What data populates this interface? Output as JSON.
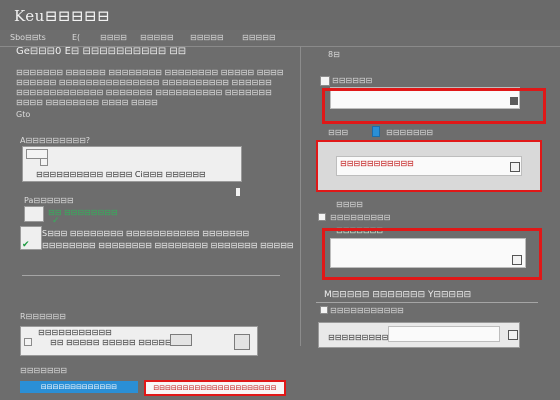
{
  "header": {
    "title": "Keu⊟⊟⊟⊟⊟"
  },
  "tabs": [
    "Sbo⊟⊟ts",
    "E(",
    "⊟⊟⊟⊟",
    "⊟⊟⊟⊟⊟",
    "⊟⊟⊟⊟⊟",
    "⊟⊟⊟⊟⊟"
  ],
  "left": {
    "heading": "Ge⊟⊟⊟0 E⊟ ⊟⊟⊟⊟⊟⊟⊟⊟⊟⊟ ⊟⊟",
    "para_lines": [
      "⊟⊟⊟⊟⊟⊟⊟ ⊟⊟⊟⊟⊟⊟ ⊟⊟⊟⊟⊟⊟⊟⊟ ⊟⊟⊟⊟⊟⊟⊟⊟ ⊟⊟⊟⊟⊟ ⊟⊟⊟⊟",
      "⊟⊟⊟⊟⊟⊟ ⊟⊟⊟⊟⊟⊟⊟⊟⊟⊟⊟⊟⊟⊟⊟ ⊟⊟⊟⊟⊟⊟⊟⊟⊟⊟ ⊟⊟⊟⊟⊟⊟",
      "⊟⊟⊟⊟⊟⊟⊟⊟⊟⊟⊟⊟⊟ ⊟⊟⊟⊟⊟⊟⊟ ⊟⊟⊟⊟⊟⊟⊟⊟⊟⊟ ⊟⊟⊟⊟⊟⊟⊟",
      "⊟⊟⊟⊟ ⊟⊟⊟⊟⊟⊟⊟⊟ ⊟⊟⊟⊟ ⊟⊟⊟⊟"
    ],
    "para_label": "Gto",
    "section1": {
      "label": "A⊟⊟⊟⊟⊟⊟⊟⊟⊟?",
      "row_text": "⊟⊟⊟⊟⊟⊟⊟⊟⊟⊟ ⊟⊟⊟⊟ Ci⊟⊟⊟ ⊟⊟⊟⊟⊟⊟"
    },
    "section2": {
      "label": "Pa⊟⊟⊟⊟⊟⊟",
      "opt1": "⊟⊟ ⊟⊟⊟⊟⊟⊟⊟⊟",
      "opt2": "S⊟⊟⊟ ⊟⊟⊟⊟⊟⊟⊟⊟ ⊟⊟⊟⊟⊟⊟⊟⊟⊟⊟⊟ ⊟⊟⊟⊟⊟⊟⊟",
      "opt3": "⊟⊟⊟⊟⊟⊟⊟⊟ ⊟⊟⊟⊟⊟⊟⊟⊟ ⊟⊟⊟⊟⊟⊟⊟⊟ ⊟⊟⊟⊟⊟⊟⊟ ⊟⊟⊟⊟⊟"
    },
    "section3": {
      "label": "R⊟⊟⊟⊟⊟⊟",
      "row_title": "⊟⊟⊟⊟⊟⊟⊟⊟⊟⊟⊟",
      "row_text": "⊟⊟ ⊟⊟⊟⊟⊟ ⊟⊟⊟⊟⊟ ⊟⊟⊟⊟⊟"
    },
    "bottom_label": "⊟⊟⊟⊟⊟⊟⊟",
    "blue_button": "⊟⊟⊟⊟⊟⊟⊟⊟⊟⊟⊟⊟⊟",
    "red_button": "⊟⊟⊟⊟⊟⊟⊟⊟⊟⊟⊟⊟⊟⊟⊟⊟⊟⊟⊟⊟⊟"
  },
  "right": {
    "label1": "8⊟",
    "label1b": "⊟⊟⊟⊟⊟⊟",
    "label2": "⊟⊟⊟",
    "label2b": "⊟⊟⊟⊟⊟⊟⊟",
    "box2_text": "⊟⊟⊟⊟⊟⊟⊟⊟⊟⊟⊟",
    "label3": "⊟⊟⊟⊟",
    "label3b": "⊟⊟⊟⊟⊟⊟⊟⊟⊟",
    "label3c": "⊟⊟⊟⊟⊟⊟⊟",
    "heading4": "M⊟⊟⊟⊟⊟ ⊟⊟⊟⊟⊟⊟⊟ Y⊟⊟⊟⊟⊟",
    "row4a": "⊟⊟⊟⊟⊟⊟⊟⊟⊟⊟⊟",
    "row4b": "⊟⊟⊟⊟⊟⊟⊟⊟⊟⊟⊟"
  },
  "colors": {
    "bg": "#6d6d6d",
    "accent_red": "#e01818",
    "accent_blue": "#2a8fd6",
    "accent_green": "#1c9a40"
  }
}
